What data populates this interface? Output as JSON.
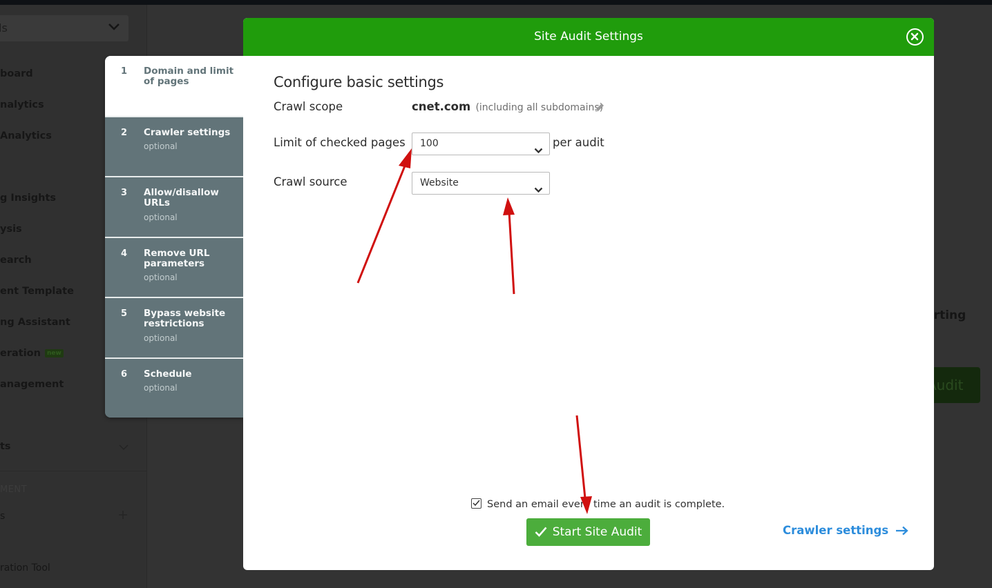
{
  "sidebar": {
    "select_label": "ls",
    "items": [
      {
        "label": "board",
        "top": 0
      },
      {
        "label": "nalytics"
      },
      {
        "label": "Analytics"
      },
      {
        "label": "g Insights"
      },
      {
        "label": "ysis"
      },
      {
        "label": "earch"
      },
      {
        "label": "ent Template"
      },
      {
        "label": "ng Assistant"
      },
      {
        "label": "eration",
        "badge": "new"
      },
      {
        "label": "anagement"
      }
    ],
    "collapsible_label": "ts",
    "section_label": "MENT",
    "section_item_label": "s",
    "bottom_item_label": "ration Tool"
  },
  "background": {
    "partial_heading": "orting",
    "partial_button": "Audit"
  },
  "steps": [
    {
      "number": "1",
      "title": "Domain and limit of pages",
      "subtitle": "",
      "active": true
    },
    {
      "number": "2",
      "title": "Crawler settings",
      "subtitle": "optional",
      "active": false
    },
    {
      "number": "3",
      "title": "Allow/disallow URLs",
      "subtitle": "optional",
      "active": false
    },
    {
      "number": "4",
      "title": "Remove URL parameters",
      "subtitle": "optional",
      "active": false
    },
    {
      "number": "5",
      "title": "Bypass website restrictions",
      "subtitle": "optional",
      "active": false
    },
    {
      "number": "6",
      "title": "Schedule",
      "subtitle": "optional",
      "active": false
    }
  ],
  "modal": {
    "title": "Site Audit Settings",
    "heading": "Configure basic settings",
    "crawl_scope": {
      "label": "Crawl scope",
      "domain": "cnet.com",
      "note": "(including all subdomains)"
    },
    "limit": {
      "label": "Limit of checked pages",
      "value": "100",
      "suffix": "per audit"
    },
    "crawl_source": {
      "label": "Crawl source",
      "value": "Website"
    },
    "email_checkbox": {
      "label": "Send an email every time an audit is complete.",
      "checked": true
    },
    "start_button": "Start Site Audit",
    "crawler_link": "Crawler settings"
  },
  "colors": {
    "header_green": "#209c0c",
    "button_green": "#4cad3c",
    "link_blue": "#2d8ddc",
    "step_gray": "#627479",
    "annotation_red": "#d0100f"
  }
}
